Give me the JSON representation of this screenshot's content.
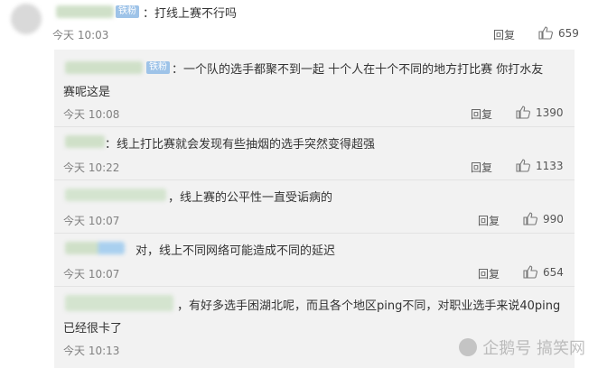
{
  "top_comment": {
    "badge": "铁粉",
    "text": "：打线上赛不行吗",
    "time": "今天 10:03",
    "reply": "回复",
    "likes": "659"
  },
  "replies": [
    {
      "badge": "铁粉",
      "text_line1": "：一个队的选手都聚不到一起 十个人在十个不同的地方打比赛 你打水友",
      "text_line2": "赛呢这是",
      "time": "今天 10:08",
      "reply": "回复",
      "likes": "1390"
    },
    {
      "text_line1": "：线上打比赛就会发现有些抽烟的选手突然变得超强",
      "time": "今天 10:22",
      "reply": "回复",
      "likes": "1133"
    },
    {
      "text_line1": "，线上赛的公平性一直受诟病的",
      "time": "今天 10:07",
      "reply": "回复",
      "likes": "990"
    },
    {
      "text_line1": "对，线上不同网络可能造成不同的延迟",
      "time": "今天 10:07",
      "reply": "回复",
      "likes": "654"
    },
    {
      "text_line1": "，有好多选手困湖北呢，而且各个地区ping不同，对职业选手来说40ping",
      "text_line2": "已经很卡了",
      "time": "今天 10:13"
    }
  ],
  "watermark": "企鹅号 搞笑网",
  "colors": {
    "badge": "#9ec3e8",
    "panel": "#f2f2f2",
    "time": "#808080"
  }
}
